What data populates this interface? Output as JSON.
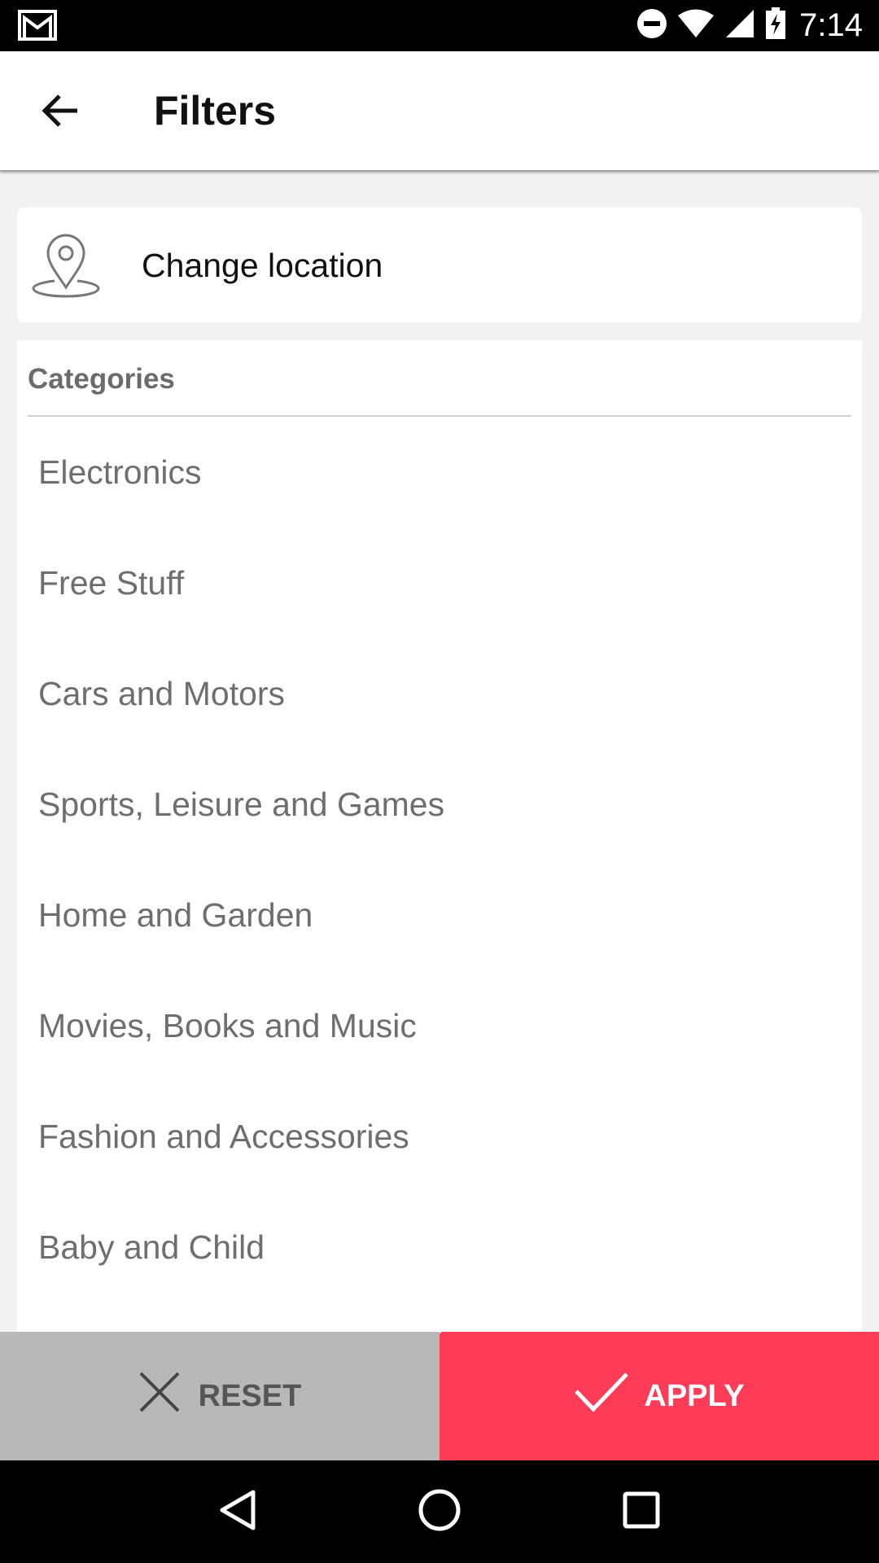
{
  "status_bar": {
    "time": "7:14",
    "icons": [
      "gmail-icon",
      "do-not-disturb-icon",
      "wifi-icon",
      "signal-icon",
      "battery-charging-icon"
    ]
  },
  "app_bar": {
    "title": "Filters",
    "back_icon": "arrow-back-icon"
  },
  "location": {
    "label": "Change location",
    "icon": "location-pin-icon"
  },
  "categories": {
    "header": "Categories",
    "items": [
      "Electronics",
      "Free Stuff",
      "Cars and Motors",
      "Sports, Leisure and Games",
      "Home and Garden",
      "Movies, Books and Music",
      "Fashion and Accessories",
      "Baby and Child"
    ]
  },
  "actions": {
    "reset_label": "RESET",
    "apply_label": "APPLY"
  },
  "colors": {
    "accent": "#ff3c58",
    "reset_bg": "#b8b8b8",
    "category_text": "#6e6e6e"
  }
}
